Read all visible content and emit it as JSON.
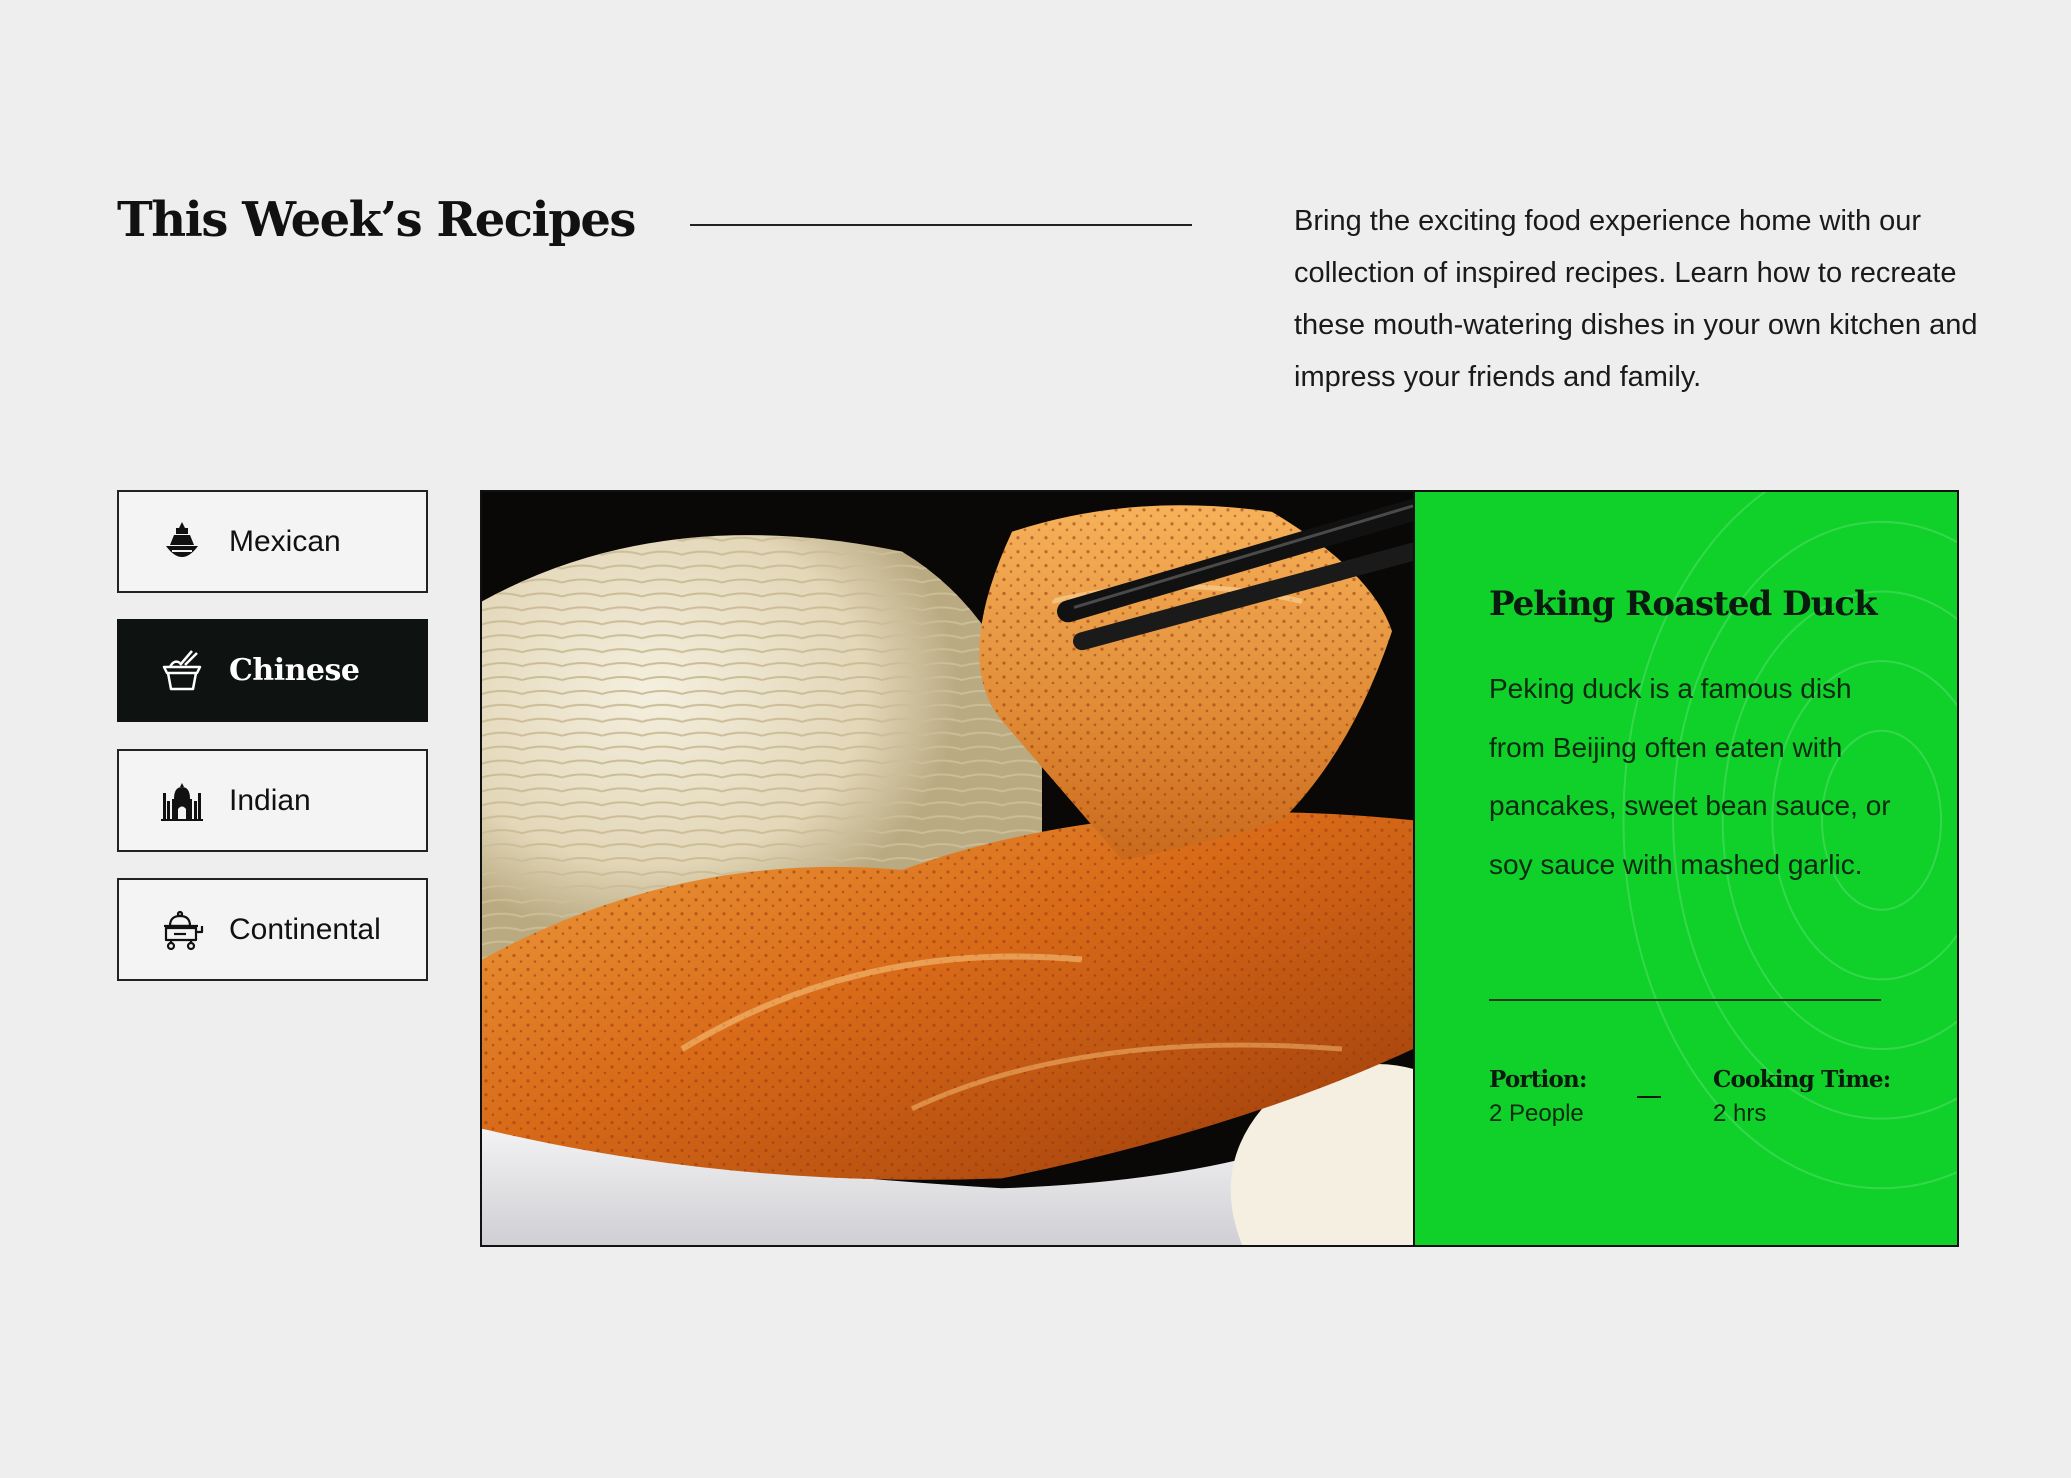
{
  "header": {
    "title": "This Week’s Recipes",
    "intro": "Bring the exciting food experience home with our collection of inspired recipes. Learn how to recreate these mouth-watering dishes in your own kitchen and impress your friends and family."
  },
  "tabs": [
    {
      "label": "Mexican",
      "icon": "sombrero-icon",
      "active": false
    },
    {
      "label": "Chinese",
      "icon": "takeout-box-chopsticks-icon",
      "active": true
    },
    {
      "label": "Indian",
      "icon": "taj-mahal-icon",
      "active": false
    },
    {
      "label": "Continental",
      "icon": "serving-cart-icon",
      "active": false
    }
  ],
  "recipe": {
    "photo_alt": "peking-duck-photo",
    "title": "Peking Roasted Duck",
    "description": "Peking duck is a famous dish from Beijing often eaten with pancakes, sweet bean sauce, or soy sauce with mashed garlic.",
    "portion_label": "Portion:",
    "portion_value": "2 People",
    "time_label": "Cooking Time:",
    "time_value": "2 hrs"
  },
  "colors": {
    "accent_green": "#0fd12a",
    "active_tab": "#0e1210",
    "background": "#eeeeee"
  }
}
